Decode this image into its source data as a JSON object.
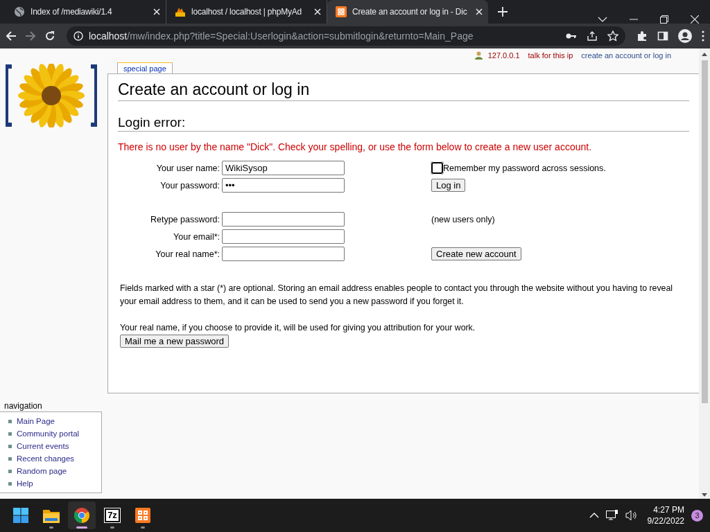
{
  "browser": {
    "tabs": [
      {
        "title": "Index of /mediawiki/1.4",
        "kind": "globe",
        "selected": false
      },
      {
        "title": "localhost / localhost | phpMyAd",
        "kind": "pma",
        "selected": false
      },
      {
        "title": "Create an account or log in - Dic",
        "kind": "xampp",
        "selected": true
      }
    ],
    "address": {
      "host": "localhost",
      "path": "/mw/index.php?title=Special:Userlogin&action=submitlogin&returnto=Main_Page"
    }
  },
  "personal_links": [
    {
      "label": "127.0.0.1",
      "kind": "user"
    },
    {
      "label": "talk for this ip",
      "kind": "new"
    },
    {
      "label": "create an account or log in",
      "kind": "link"
    }
  ],
  "page_tab": {
    "label": "special page",
    "selected": true
  },
  "title": "Create an account or log in",
  "error_heading": "Login error:",
  "error_message": "There is no user by the name \"Dick\". Check your spelling, or use the form below to create a new user account.",
  "form": {
    "rows": [
      {
        "label": "Your user name:",
        "value": "WikiSysop",
        "side": {
          "kind": "checkbox",
          "label": "Remember my password across sessions.",
          "checked": false
        }
      },
      {
        "label": "Your password:",
        "value": "•••",
        "side": {
          "kind": "button",
          "label": "Log in"
        }
      },
      {
        "kind": "spacer"
      },
      {
        "label": "Retype password:",
        "side": {
          "kind": "note",
          "label": "(new users only)"
        }
      },
      {
        "label": "Your email*:"
      },
      {
        "label": "Your real name*:",
        "side": {
          "kind": "button",
          "label": "Create new account"
        }
      }
    ]
  },
  "notes": [
    "Fields marked with a star (*) are optional. Storing an email address enables people to contact you through the website without you having to reveal your email address to them, and it can be used to send you a new password if you forget it.",
    "Your real name, if you choose to provide it, will be used for giving you attribution for your work."
  ],
  "mail_button": "Mail me a new password",
  "navigation": {
    "heading": "navigation",
    "items": [
      "Main Page",
      "Community portal",
      "Current events",
      "Recent changes",
      "Random page",
      "Help"
    ]
  },
  "taskbar": {
    "apps": [
      {
        "kind": "start",
        "selected": false
      },
      {
        "kind": "folder",
        "selected": false
      },
      {
        "kind": "chrome",
        "selected": true
      },
      {
        "kind": "archiver",
        "label": "7z",
        "selected": false
      },
      {
        "kind": "xampp",
        "selected": false
      }
    ],
    "time": "4:27 PM",
    "date": "9/22/2022",
    "badge": "3"
  }
}
